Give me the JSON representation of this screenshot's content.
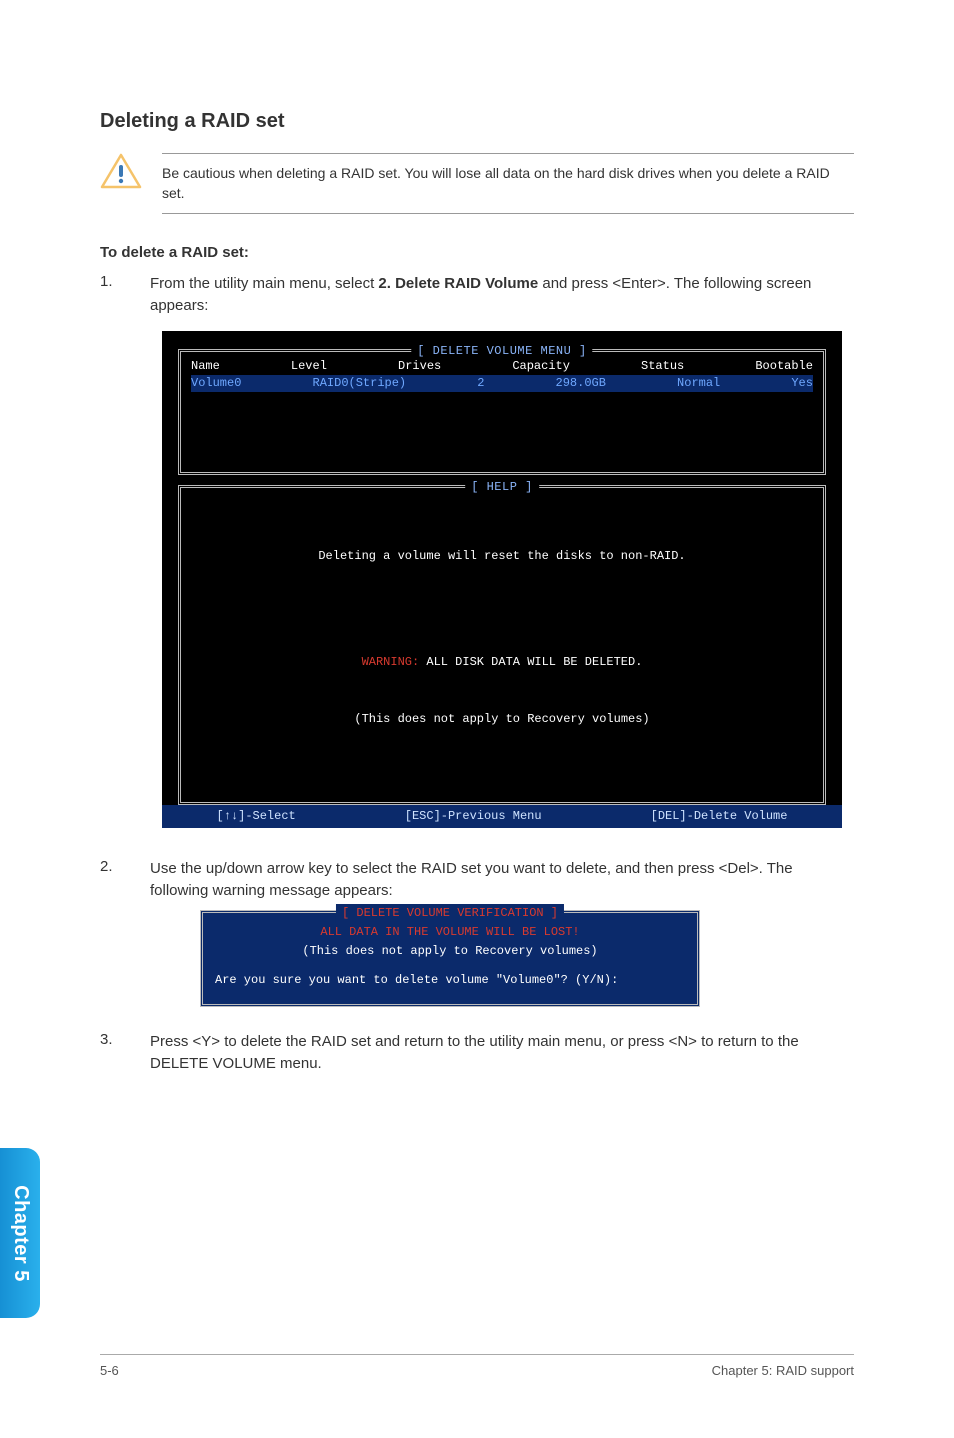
{
  "section": {
    "title": "Deleting a RAID set",
    "note": "Be cautious when deleting a RAID set. You will lose all data on the hard disk drives when you delete a RAID set.",
    "subtitle": "To delete a RAID set:"
  },
  "steps": {
    "s1": {
      "num": "1.",
      "before": "From the utility main menu, select ",
      "bold": "2. Delete RAID Volume",
      "after": " and press <Enter>. The following screen appears:"
    },
    "s2": {
      "num": "2.",
      "text": "Use the up/down arrow key to select the RAID set you want to delete, and then press <Del>. The following warning message appears:"
    },
    "s3": {
      "num": "3.",
      "text": "Press <Y> to delete the RAID set and return to the utility main menu, or press <N> to return to the DELETE VOLUME menu."
    }
  },
  "bios": {
    "menu_title": "[ DELETE VOLUME MENU ]",
    "headers": {
      "name": "Name",
      "level": "Level",
      "drives": "Drives",
      "capacity": "Capacity",
      "status": "Status",
      "bootable": "Bootable"
    },
    "row": {
      "name": "Volume0",
      "level": "RAID0(Stripe)",
      "drives": "2",
      "capacity": "298.0GB",
      "status": "Normal",
      "bootable": "Yes"
    },
    "help_title": "[ HELP ]",
    "help_line1": "Deleting a volume will reset the disks to non-RAID.",
    "help_warn_prefix": "WARNING:",
    "help_warn_rest": " ALL DISK DATA WILL BE DELETED.",
    "help_line3": "(This does not apply to Recovery volumes)",
    "footer": {
      "select": "[↑↓]-Select",
      "esc": "[ESC]-Previous Menu",
      "del": "[DEL]-Delete Volume"
    }
  },
  "dialog": {
    "title": "[ DELETE VOLUME VERIFICATION ]",
    "line1": "ALL DATA IN THE VOLUME WILL BE LOST!",
    "line2": "(This does not apply to Recovery volumes)",
    "prompt": "Are you sure you want to delete volume \"Volume0\"? (Y/N):"
  },
  "sidetab": "Chapter 5",
  "footer": {
    "left": "5-6",
    "right": "Chapter 5: RAID support"
  }
}
